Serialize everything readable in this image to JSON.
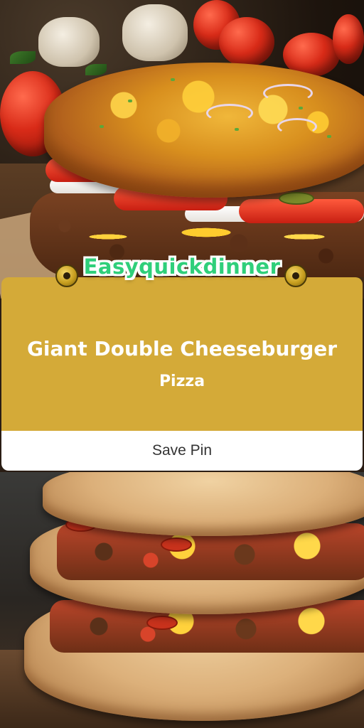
{
  "brand": {
    "name": "Easyquickdinner",
    "color": "#2fcf7a"
  },
  "card": {
    "title": "Giant Double Cheeseburger",
    "subtitle": "Pizza",
    "background": "#d4aa38",
    "save_label": "Save Pin"
  },
  "images": {
    "top": "photo-cheeseburger-pizza-top",
    "bottom": "photo-cheeseburger-pizza-stack"
  }
}
